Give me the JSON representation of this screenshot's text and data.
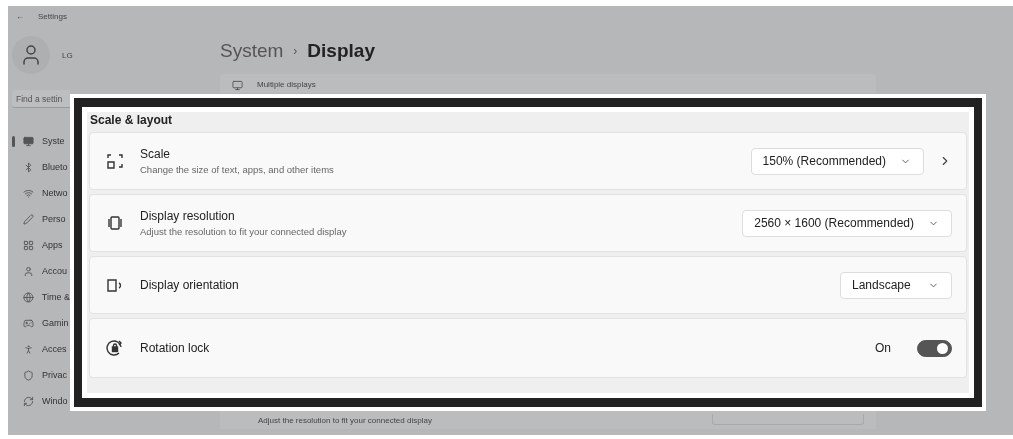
{
  "window": {
    "title": "Settings",
    "back": "←"
  },
  "user": {
    "name": "LG"
  },
  "search": {
    "placeholder": "Find a settin"
  },
  "sidebar": {
    "items": [
      {
        "label": "Syste",
        "selected": true
      },
      {
        "label": "Blueto",
        "selected": false
      },
      {
        "label": "Netwo",
        "selected": false
      },
      {
        "label": "Perso",
        "selected": false
      },
      {
        "label": "Apps",
        "selected": false
      },
      {
        "label": "Accou",
        "selected": false
      },
      {
        "label": "Time &",
        "selected": false
      },
      {
        "label": "Gamin",
        "selected": false
      },
      {
        "label": "Acces",
        "selected": false
      },
      {
        "label": "Privac",
        "selected": false
      },
      {
        "label": "Windo",
        "selected": false
      }
    ]
  },
  "breadcrumb": {
    "parent": "System",
    "separator": "›",
    "current": "Display"
  },
  "background_cards": [
    {
      "title": "Multiple displays"
    },
    {
      "description": "Adjust the resolution to fit your connected display"
    }
  ],
  "callout": {
    "section_title": "Scale & layout",
    "rows": [
      {
        "kind": "dropdown",
        "title": "Scale",
        "description": "Change the size of text, apps, and other items",
        "value": "150% (Recommended)",
        "navigates": true
      },
      {
        "kind": "dropdown",
        "title": "Display resolution",
        "description": "Adjust the resolution to fit your connected display",
        "value": "2560 × 1600 (Recommended)",
        "navigates": false
      },
      {
        "kind": "dropdown",
        "title": "Display orientation",
        "value": "Landscape",
        "navigates": false
      },
      {
        "kind": "toggle",
        "title": "Rotation lock",
        "state_label": "On",
        "on": true
      }
    ]
  }
}
